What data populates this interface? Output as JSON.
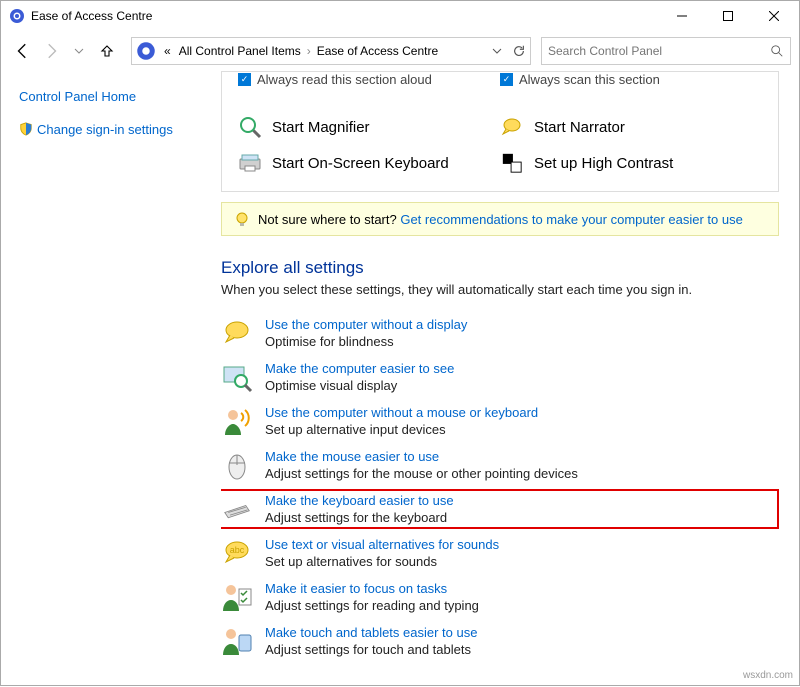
{
  "window": {
    "title": "Ease of Access Centre"
  },
  "breadcrumb": {
    "all": "All Control Panel Items",
    "current": "Ease of Access Centre"
  },
  "search": {
    "placeholder": "Search Control Panel"
  },
  "sidebar": {
    "home": "Control Panel Home",
    "signin": "Change sign-in settings"
  },
  "quick": {
    "hdr_read": "Always read this section aloud",
    "hdr_scan": "Always scan this section",
    "magnifier": "Start Magnifier",
    "narrator": "Start Narrator",
    "osk": "Start On-Screen Keyboard",
    "contrast": "Set up High Contrast"
  },
  "hint": {
    "text": "Not sure where to start? ",
    "link": "Get recommendations to make your computer easier to use"
  },
  "explore": {
    "heading": "Explore all settings",
    "sub": "When you select these settings, they will automatically start each time you sign in."
  },
  "settings": {
    "display": {
      "link": "Use the computer without a display",
      "desc": "Optimise for blindness"
    },
    "see": {
      "link": "Make the computer easier to see",
      "desc": "Optimise visual display"
    },
    "mousekb": {
      "link": "Use the computer without a mouse or keyboard",
      "desc": "Set up alternative input devices"
    },
    "mouse": {
      "link": "Make the mouse easier to use",
      "desc": "Adjust settings for the mouse or other pointing devices"
    },
    "keyboard": {
      "link": "Make the keyboard easier to use",
      "desc": "Adjust settings for the keyboard"
    },
    "sound": {
      "link": "Use text or visual alternatives for sounds",
      "desc": "Set up alternatives for sounds"
    },
    "focus": {
      "link": "Make it easier to focus on tasks",
      "desc": "Adjust settings for reading and typing"
    },
    "touch": {
      "link": "Make touch and tablets easier to use",
      "desc": "Adjust settings for touch and tablets"
    }
  },
  "watermark": "wsxdn.com"
}
